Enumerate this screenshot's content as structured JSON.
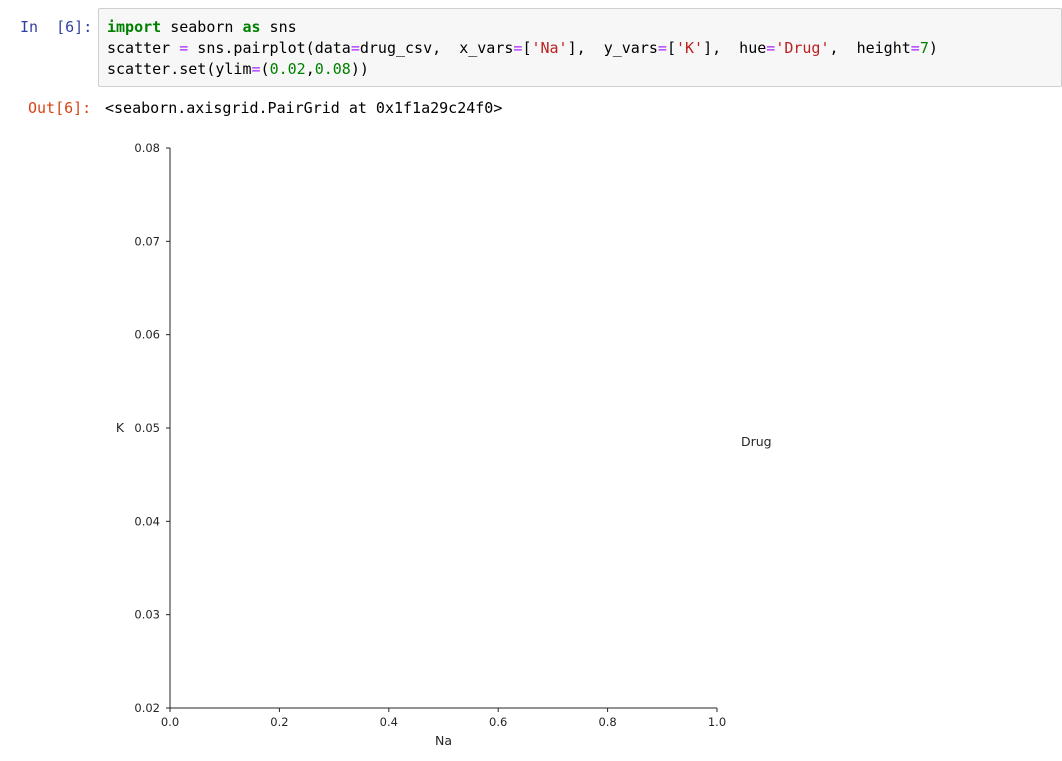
{
  "input_cell": {
    "prompt": "In  [6]:",
    "code_lines": [
      [
        {
          "t": "import",
          "c": "kw"
        },
        {
          "t": " seaborn ",
          "c": ""
        },
        {
          "t": "as",
          "c": "kw"
        },
        {
          "t": " sns",
          "c": ""
        }
      ],
      [
        {
          "t": "scatter ",
          "c": ""
        },
        {
          "t": "=",
          "c": "op"
        },
        {
          "t": " sns.pairplot(data",
          "c": ""
        },
        {
          "t": "=",
          "c": "op"
        },
        {
          "t": "drug_csv,  x_vars",
          "c": ""
        },
        {
          "t": "=",
          "c": "op"
        },
        {
          "t": "[",
          "c": ""
        },
        {
          "t": "'Na'",
          "c": "str"
        },
        {
          "t": "],  y_vars",
          "c": ""
        },
        {
          "t": "=",
          "c": "op"
        },
        {
          "t": "[",
          "c": ""
        },
        {
          "t": "'K'",
          "c": "str"
        },
        {
          "t": "],  hue",
          "c": ""
        },
        {
          "t": "=",
          "c": "op"
        },
        {
          "t": "'Drug'",
          "c": "str"
        },
        {
          "t": ",  height",
          "c": ""
        },
        {
          "t": "=",
          "c": "op"
        },
        {
          "t": "7",
          "c": "num"
        },
        {
          "t": ")",
          "c": ""
        }
      ],
      [
        {
          "t": "scatter.set(ylim",
          "c": ""
        },
        {
          "t": "=",
          "c": "op"
        },
        {
          "t": "(",
          "c": ""
        },
        {
          "t": "0.02",
          "c": "num"
        },
        {
          "t": ",",
          "c": ""
        },
        {
          "t": "0.08",
          "c": "num"
        },
        {
          "t": "))",
          "c": ""
        }
      ]
    ]
  },
  "output_cell": {
    "prompt": "Out[6]:",
    "text": "<seaborn.axisgrid.PairGrid at 0x1f1a29c24f0>"
  },
  "colors": {
    "input_prompt": "#303F9F",
    "output_prompt": "#D84315",
    "keyword": "#008000",
    "operator": "#aa22ff",
    "string": "#ba2121",
    "code_bg": "#f7f7f7",
    "axis": "#262626"
  },
  "chart_data": {
    "type": "scatter",
    "xlabel": "Na",
    "ylabel": "K",
    "xlim": [
      0.0,
      1.0
    ],
    "ylim": [
      0.02,
      0.08
    ],
    "xticks": [
      "0.0",
      "0.2",
      "0.4",
      "0.6",
      "0.8",
      "1.0"
    ],
    "yticks": [
      "0.02",
      "0.03",
      "0.04",
      "0.05",
      "0.06",
      "0.07",
      "0.08"
    ],
    "legend_title": "Drug",
    "legend_position": "right",
    "series": [],
    "grid": false
  }
}
